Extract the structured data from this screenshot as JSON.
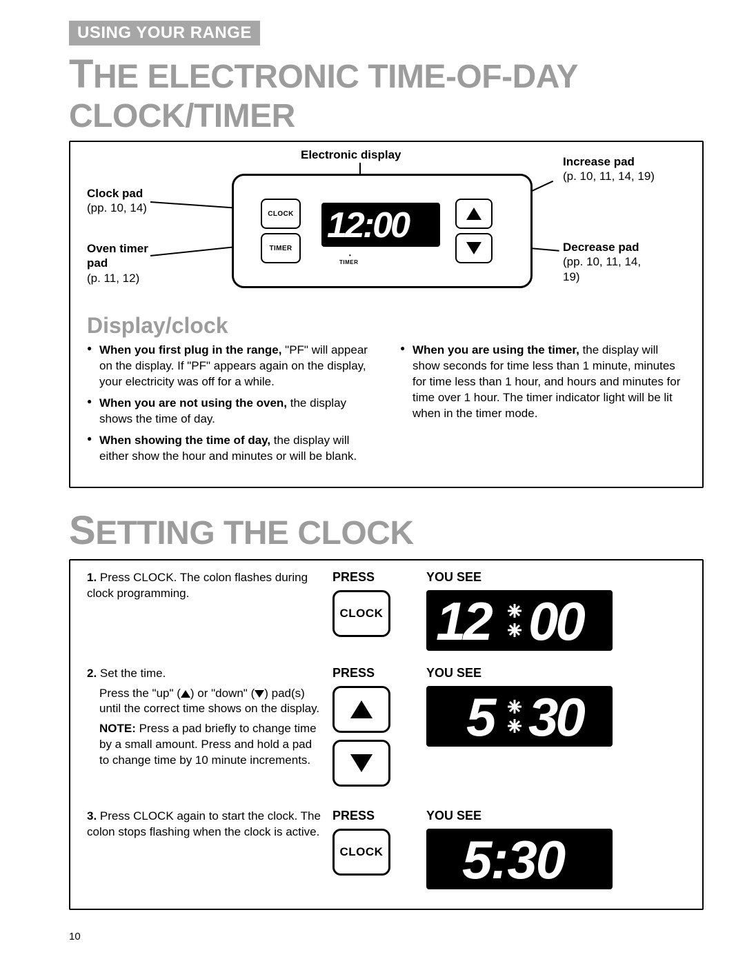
{
  "sectionTag": "USING YOUR RANGE",
  "title_pre": "T",
  "title_rest": "HE ELECTRONIC TIME-OF-DAY CLOCK/TIMER",
  "diagram": {
    "electronic_display": "Electronic display",
    "clock_pad_label": "Clock pad",
    "clock_pad_ref": "(pp. 10, 14)",
    "oven_timer_label": "Oven timer pad",
    "oven_timer_ref": "(p. 11, 12)",
    "increase_label": "Increase pad",
    "increase_ref": "(p. 10, 11, 14, 19)",
    "decrease_label": "Decrease pad",
    "decrease_ref": "(pp. 10, 11, 14, 19)",
    "btn_clock": "CLOCK",
    "btn_timer": "TIMER",
    "sub_timer": "TIMER",
    "display_value": "12:00"
  },
  "displayClock": {
    "heading": "Display/clock",
    "left": [
      {
        "bold": "When you first plug in the range,",
        "rest": " \"PF\" will appear on the display. If \"PF\" appears again on the display, your electricity was off for a while."
      },
      {
        "bold": "When you are not using the oven,",
        "rest": " the display shows the time of day."
      },
      {
        "bold": "When showing the time of day,",
        "rest": " the display will either show the hour and minutes or will be blank."
      }
    ],
    "right": [
      {
        "bold": "When you are using the timer,",
        "rest": " the display will show seconds for time less than 1 minute, minutes for time less than 1 hour, and hours and minutes for time over 1 hour. The timer indicator light will be lit when in the timer mode."
      }
    ]
  },
  "setting": {
    "heading_pre": "S",
    "heading_rest": "ETTING THE CLOCK",
    "col_press": "PRESS",
    "col_see": "YOU SEE",
    "btn_clock": "CLOCK",
    "steps": [
      {
        "num": "1.",
        "text": " Press CLOCK. The colon flashes during clock programming."
      },
      {
        "num": "2.",
        "text_lead": " Set the time.",
        "text_body": "Press the \"up\" (▲) or \"down\" (▼) pad(s) until the correct time shows on the display.",
        "note_label": "NOTE:",
        "note_body": " Press a pad briefly to change time by a small amount. Press and hold a pad to change time by 10 minute increments."
      },
      {
        "num": "3.",
        "text": " Press CLOCK again to start the clock. The colon stops flashing when the clock is active."
      }
    ],
    "display1": "12:00",
    "display2": "5:30",
    "display3": "5:30"
  },
  "pageNumber": "10"
}
